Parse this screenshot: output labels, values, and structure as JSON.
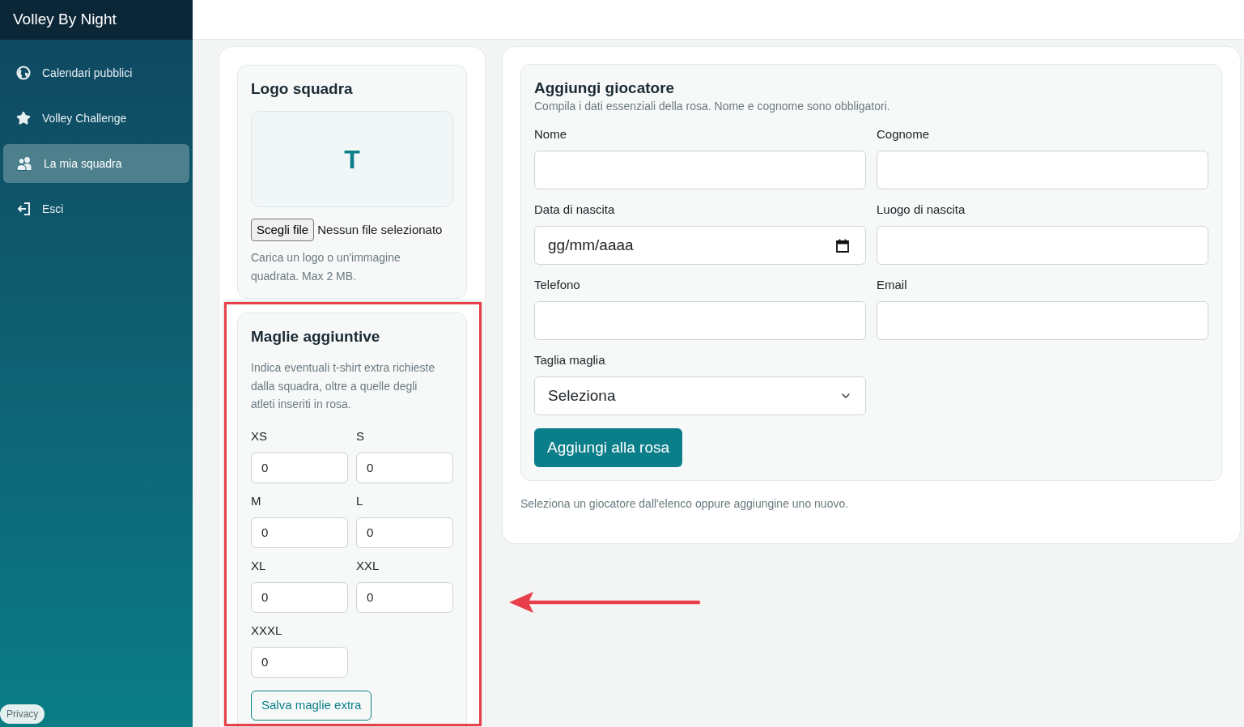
{
  "sidebar": {
    "brand": "Volley By Night",
    "items": [
      {
        "label": "Calendari pubblici",
        "selected": false
      },
      {
        "label": "Volley Challenge",
        "selected": false
      },
      {
        "label": "La mia squadra",
        "selected": true
      },
      {
        "label": "Esci",
        "selected": false
      }
    ],
    "privacy": "Privacy"
  },
  "logo_card": {
    "title": "Logo squadra",
    "logo_letter": "T",
    "file_button": "Scegli file",
    "file_status": "Nessun file selezionato",
    "hint": "Carica un logo o un'immagine quadrata. Max 2 MB."
  },
  "extra_shirts": {
    "title": "Maglie aggiuntive",
    "description": "Indica eventuali t-shirt extra richieste dalla squadra, oltre a quelle degli atleti inseriti in rosa.",
    "sizes": [
      {
        "label": "XS",
        "value": "0"
      },
      {
        "label": "S",
        "value": "0"
      },
      {
        "label": "M",
        "value": "0"
      },
      {
        "label": "L",
        "value": "0"
      },
      {
        "label": "XL",
        "value": "0"
      },
      {
        "label": "XXL",
        "value": "0"
      },
      {
        "label": "XXXL",
        "value": "0"
      }
    ],
    "save_button": "Salva maglie extra"
  },
  "player_form": {
    "title": "Aggiungi giocatore",
    "subtitle": "Compila i dati essenziali della rosa. Nome e cognome sono obbligatori.",
    "fields": [
      {
        "label": "Nome",
        "kind": "text"
      },
      {
        "label": "Cognome",
        "kind": "text"
      },
      {
        "label": "Data di nascita",
        "kind": "date",
        "placeholder": "gg/mm/aaaa"
      },
      {
        "label": "Luogo di nascita",
        "kind": "text"
      },
      {
        "label": "Telefono",
        "kind": "text"
      },
      {
        "label": "Email",
        "kind": "text"
      },
      {
        "label": "Taglia maglia",
        "kind": "select",
        "value": "Seleziona"
      }
    ],
    "submit_button": "Aggiungi alla rosa",
    "empty_hint": "Seleziona un giocatore dall'elenco oppure aggiungine uno nuovo."
  },
  "annotations": [
    {
      "kind": "frame"
    },
    {
      "kind": "arrow"
    }
  ]
}
